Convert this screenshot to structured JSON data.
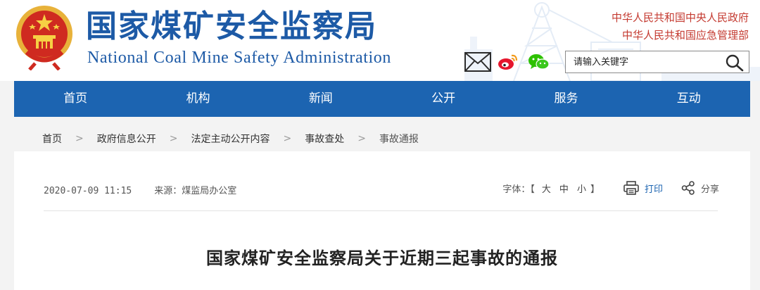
{
  "header": {
    "title_cn": "国家煤矿安全监察局",
    "title_en": "National Coal Mine Safety Administration",
    "gov_links": [
      "中华人民共和国中央人民政府",
      "中华人民共和国应急管理部"
    ],
    "icons": {
      "emblem": "national-emblem",
      "mail": "mail-icon",
      "weibo": "weibo-icon",
      "wechat": "wechat-icon",
      "search": "search-icon"
    },
    "brand_color": "#1d5aa6",
    "link_color": "#c43a30"
  },
  "search": {
    "placeholder": "请输入关键字",
    "value": ""
  },
  "nav": {
    "items": [
      "首页",
      "机构",
      "新闻",
      "公开",
      "服务",
      "互动"
    ],
    "color": "#1c64b1"
  },
  "breadcrumb": {
    "items": [
      "首页",
      "政府信息公开",
      "法定主动公开内容",
      "事故查处",
      "事故通报"
    ],
    "separator": ">"
  },
  "article": {
    "date": "2020-07-09 11:15",
    "source": "来源：煤监局办公室",
    "font_label": "字体：【",
    "font_sizes": [
      "大",
      "中",
      "小"
    ],
    "font_close": "】",
    "print_label": "打印",
    "share_label": "分享",
    "title": "国家煤矿安全监察局关于近期三起事故的通报"
  }
}
